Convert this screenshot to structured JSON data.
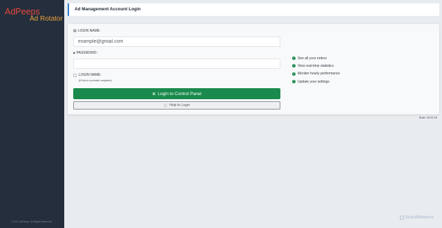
{
  "sidebar": {
    "logo_top": "AdPeeps",
    "logo_bottom": "Ad Rotator",
    "footer": "© 2017 AdPeeps. All Rights Reserved."
  },
  "header": {
    "title": "Ad Management Account Login"
  },
  "form": {
    "login_label": "LOGIN NAME:",
    "login_placeholder": "example@gmail.com",
    "password_label": "PASSWORD:",
    "password_value": "",
    "remember_label": "LOGIN NAME:",
    "remember_note": "(If this is a private computer)",
    "login_button": "Login to Control Panel",
    "help_button": "Help to Login"
  },
  "features": [
    {
      "label": "See all your orders"
    },
    {
      "label": "View real-time statistics"
    },
    {
      "label": "Monitor hourly performance"
    },
    {
      "label": "Update your settings"
    }
  ],
  "build": {
    "label": "Build:",
    "value": "00.02.18"
  },
  "watermark": "ScanMalware",
  "colors": {
    "sidebar_bg": "#242e3c",
    "accent": "#2b7bd1",
    "primary_button": "#1a8a4c",
    "logo_red": "#e8473c",
    "logo_orange": "#e8a33c"
  },
  "icons": {
    "login_field": "id-card-icon",
    "password_field": "lock-icon",
    "login_button": "sign-in-icon",
    "help_button": "question-circle-icon",
    "feature": "check-circle-icon"
  }
}
